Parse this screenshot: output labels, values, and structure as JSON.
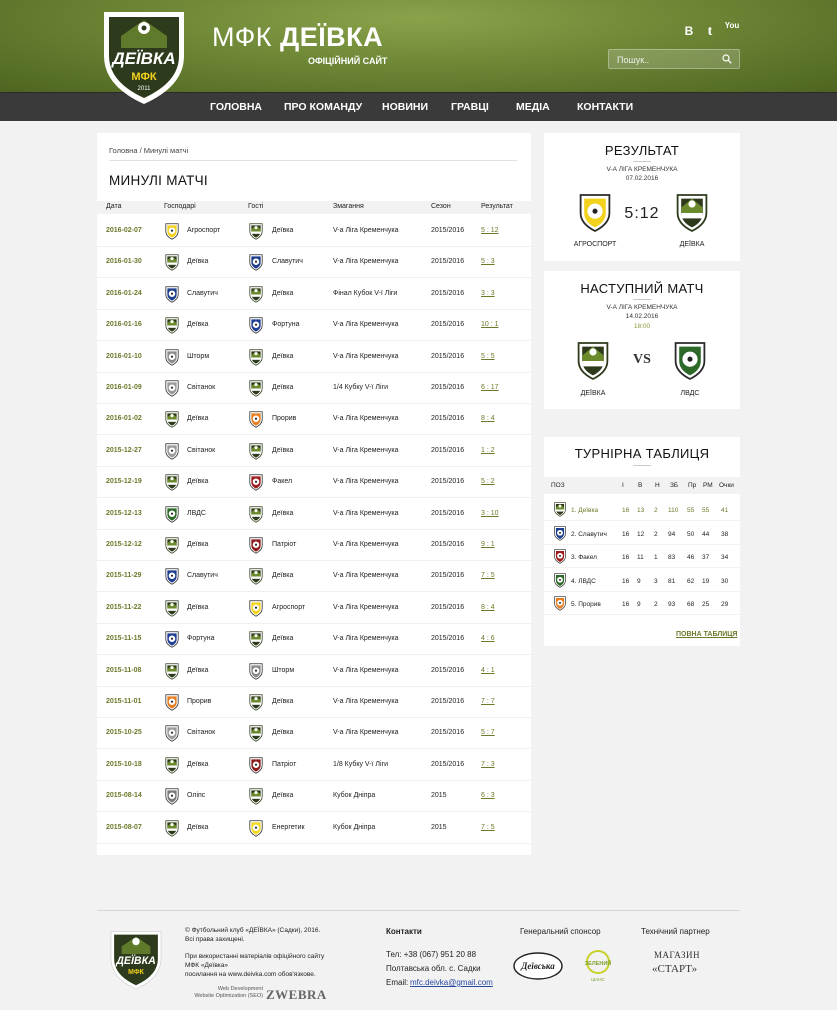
{
  "site": {
    "title_light": "МФК",
    "title_bold": "ДЕЇВКА",
    "subtitle": "ОФІЦІЙНИЙ САЙТ",
    "logo_text_top": "ДЕЇВКА",
    "logo_text_bottom": "МФК",
    "logo_year": "2011"
  },
  "social": [
    {
      "icon": "vk-icon",
      "glyph": "B"
    },
    {
      "icon": "twitter-icon",
      "glyph": "t"
    },
    {
      "icon": "youtube-icon",
      "glyph": "You"
    }
  ],
  "search": {
    "placeholder": "Пошук.."
  },
  "nav": [
    "ГОЛОВНА",
    "ПРО КОМАНДУ",
    "НОВИНИ",
    "ГРАВЦІ",
    "МЕДІА",
    "КОНТАКТИ"
  ],
  "breadcrumb": "Головна / Минулі матчі",
  "page_title": "МИНУЛІ МАТЧІ",
  "table": {
    "columns": [
      "Дата",
      "Господарі",
      "Гості",
      "Змагання",
      "Сезон",
      "Результат"
    ],
    "rows": [
      {
        "date": "2016-02-07",
        "home": "Агроспорт",
        "away": "Деївка",
        "comp": "V-а Ліга Кременчука",
        "season": "2015/2016",
        "score": "5 : 12",
        "hc": "agro",
        "ac": "deivka"
      },
      {
        "date": "2016-01-30",
        "home": "Деївка",
        "away": "Славутич",
        "comp": "V-а Ліга Кременчука",
        "season": "2015/2016",
        "score": "5 : 3",
        "hc": "deivka",
        "ac": "slav"
      },
      {
        "date": "2016-01-24",
        "home": "Славутич",
        "away": "Деївка",
        "comp": "Фінал Кубок V-ї Ліги",
        "season": "2015/2016",
        "score": "3 : 3",
        "hc": "slav",
        "ac": "deivka"
      },
      {
        "date": "2016-01-16",
        "home": "Деївка",
        "away": "Фортуна",
        "comp": "V-а Ліга Кременчука",
        "season": "2015/2016",
        "score": "10 : 1",
        "hc": "deivka",
        "ac": "fortuna"
      },
      {
        "date": "2016-01-10",
        "home": "Шторм",
        "away": "Деївка",
        "comp": "V-а Ліга Кременчука",
        "season": "2015/2016",
        "score": "5 : 5",
        "hc": "shtorm",
        "ac": "deivka"
      },
      {
        "date": "2016-01-09",
        "home": "Світанок",
        "away": "Деївка",
        "comp": "1/4 Кубку V-ї Ліги",
        "season": "2015/2016",
        "score": "6 : 17",
        "hc": "svitanok",
        "ac": "deivka"
      },
      {
        "date": "2016-01-02",
        "home": "Деївка",
        "away": "Прорив",
        "comp": "V-а Ліга Кременчука",
        "season": "2015/2016",
        "score": "8 : 4",
        "hc": "deivka",
        "ac": "proryv"
      },
      {
        "date": "2015-12-27",
        "home": "Світанок",
        "away": "Деївка",
        "comp": "V-а Ліга Кременчука",
        "season": "2015/2016",
        "score": "1 : 2",
        "hc": "svitanok",
        "ac": "deivka"
      },
      {
        "date": "2015-12-19",
        "home": "Деївка",
        "away": "Факел",
        "comp": "V-а Ліга Кременчука",
        "season": "2015/2016",
        "score": "5 : 2",
        "hc": "deivka",
        "ac": "fakel"
      },
      {
        "date": "2015-12-13",
        "home": "ЛВДС",
        "away": "Деївка",
        "comp": "V-а Ліга Кременчука",
        "season": "2015/2016",
        "score": "3 : 10",
        "hc": "lvds",
        "ac": "deivka"
      },
      {
        "date": "2015-12-12",
        "home": "Деївка",
        "away": "Патріот",
        "comp": "V-а Ліга Кременчука",
        "season": "2015/2016",
        "score": "9 : 1",
        "hc": "deivka",
        "ac": "patriot"
      },
      {
        "date": "2015-11-29",
        "home": "Славутич",
        "away": "Деївка",
        "comp": "V-а Ліга Кременчука",
        "season": "2015/2016",
        "score": "7 : 5",
        "hc": "slav",
        "ac": "deivka"
      },
      {
        "date": "2015-11-22",
        "home": "Деївка",
        "away": "Агроспорт",
        "comp": "V-а Ліга Кременчука",
        "season": "2015/2016",
        "score": "8 : 4",
        "hc": "deivka",
        "ac": "agro"
      },
      {
        "date": "2015-11-15",
        "home": "Фортуна",
        "away": "Деївка",
        "comp": "V-а Ліга Кременчука",
        "season": "2015/2016",
        "score": "4 : 6",
        "hc": "fortuna",
        "ac": "deivka"
      },
      {
        "date": "2015-11-08",
        "home": "Деївка",
        "away": "Шторм",
        "comp": "V-а Ліга Кременчука",
        "season": "2015/2016",
        "score": "4 : 1",
        "hc": "deivka",
        "ac": "shtorm"
      },
      {
        "date": "2015-11-01",
        "home": "Прорив",
        "away": "Деївка",
        "comp": "V-а Ліга Кременчука",
        "season": "2015/2016",
        "score": "7 : 7",
        "hc": "proryv",
        "ac": "deivka"
      },
      {
        "date": "2015-10-25",
        "home": "Світанок",
        "away": "Деївка",
        "comp": "V-а Ліга Кременчука",
        "season": "2015/2016",
        "score": "5 : 7",
        "hc": "svitanok",
        "ac": "deivka"
      },
      {
        "date": "2015-10-18",
        "home": "Деївка",
        "away": "Патріот",
        "comp": "1/8 Кубку V-ї Ліги",
        "season": "2015/2016",
        "score": "7 : 3",
        "hc": "deivka",
        "ac": "patriot"
      },
      {
        "date": "2015-08-14",
        "home": "Оліпс",
        "away": "Деївка",
        "comp": "Кубок Дніпра",
        "season": "2015",
        "score": "6 : 3",
        "hc": "olips",
        "ac": "deivka"
      },
      {
        "date": "2015-08-07",
        "home": "Деївка",
        "away": "Енергетик",
        "comp": "Кубок Дніпра",
        "season": "2015",
        "score": "7 : 5",
        "hc": "deivka",
        "ac": "energetyk"
      }
    ]
  },
  "result_widget": {
    "title": "РЕЗУЛЬТАТ",
    "league": "V-А ЛІГА КРЕМЕНЧУКА",
    "date": "07.02.2016",
    "home": "АГРОСПОРТ",
    "away": "ДЕЇВКА",
    "score": "5:12",
    "hc": "agro",
    "ac": "deivka"
  },
  "next_widget": {
    "title": "НАСТУПНИЙ МАТЧ",
    "league": "V-А ЛІГА КРЕМЕНЧУКА",
    "date": "14.02.2016",
    "time": "18:00",
    "home": "ДЕЇВКА",
    "away": "ЛВДС",
    "vs": "VS",
    "hc": "deivka",
    "ac": "lvds"
  },
  "standings": {
    "title": "ТУРНІРНА ТАБЛИЦЯ",
    "columns": [
      "ПОЗ",
      "І",
      "В",
      "Н",
      "ЗБ",
      "Пр",
      "РМ",
      "Очки"
    ],
    "rows": [
      {
        "team": "1. Деївка",
        "c": "deivka",
        "vals": [
          "16",
          "13",
          "2",
          "110",
          "55",
          "55",
          "41"
        ]
      },
      {
        "team": "2. Славутич",
        "c": "slav",
        "vals": [
          "16",
          "12",
          "2",
          "94",
          "50",
          "44",
          "38"
        ]
      },
      {
        "team": "3. Факел",
        "c": "fakel",
        "vals": [
          "16",
          "11",
          "1",
          "83",
          "46",
          "37",
          "34"
        ]
      },
      {
        "team": "4. ЛВДС",
        "c": "lvds",
        "vals": [
          "16",
          "9",
          "3",
          "81",
          "62",
          "19",
          "30"
        ]
      },
      {
        "team": "5. Прорив",
        "c": "proryv",
        "vals": [
          "16",
          "9",
          "2",
          "93",
          "68",
          "25",
          "29"
        ]
      }
    ],
    "full_link": "ПОВНА ТАБЛИЦЯ"
  },
  "crest_colors": {
    "deivka": "#2e3a1c",
    "agro": "#f2d21c",
    "slav": "#1d3e8c",
    "fortuna": "#1f3f94",
    "shtorm": "#8a8a8a",
    "svitanok": "#9a9a9a",
    "proryv": "#e67d1e",
    "fakel": "#9e1c1c",
    "lvds": "#2d6a2a",
    "patriot": "#8e1a1a",
    "olips": "#7a7a7a",
    "energetyk": "#f3d81e"
  },
  "footer": {
    "copyright": [
      "© Футбольний клуб «ДЕЇВКА» (Садки), 2016.",
      "Всі права захищені."
    ],
    "notice": [
      "При використанні матеріалів офіційного сайту",
      "МФК «Деївка»",
      "посилання на www.deivka.com обов'язкове."
    ],
    "notice_link": "www.deivka.com",
    "dev": [
      "Web Development",
      "Website Optimization (SEO)"
    ],
    "dev_brand": "ZWEBRA",
    "contacts_head": "Контакти",
    "phone": "Тел: +38 (067) 951 20 88",
    "address": "Полтавська обл. с. Садки",
    "email_label": "Email:",
    "email": "mfc.deivka@gmail.com",
    "sponsor_head": "Генеральний спонсор",
    "sponsor1": "Деївська",
    "sponsor2_a": "ЗЕЛЕНИЙ",
    "sponsor2_b": "ШАНС",
    "partner_head": "Технічний партнер",
    "partner_a": "МАГАЗИН",
    "partner_b": "«СТАРТ»"
  }
}
